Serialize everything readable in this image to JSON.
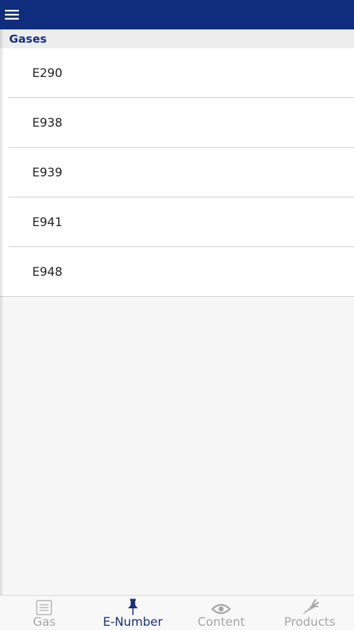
{
  "header": {
    "menu_icon": "hamburger-icon"
  },
  "section": {
    "title": "Gases"
  },
  "list": {
    "items": [
      {
        "label": "E290"
      },
      {
        "label": "E938"
      },
      {
        "label": "E939"
      },
      {
        "label": "E941"
      },
      {
        "label": "E948"
      }
    ]
  },
  "tabs": [
    {
      "label": "Gas",
      "icon": "list-icon",
      "active": false
    },
    {
      "label": "E-Number",
      "icon": "pin-icon",
      "active": true
    },
    {
      "label": "Content",
      "icon": "eye-icon",
      "active": false
    },
    {
      "label": "Products",
      "icon": "carrot-icon",
      "active": false
    }
  ],
  "colors": {
    "primary": "#0f2c7d",
    "accent_text": "#1a2f80",
    "inactive": "#a7a7a7"
  }
}
